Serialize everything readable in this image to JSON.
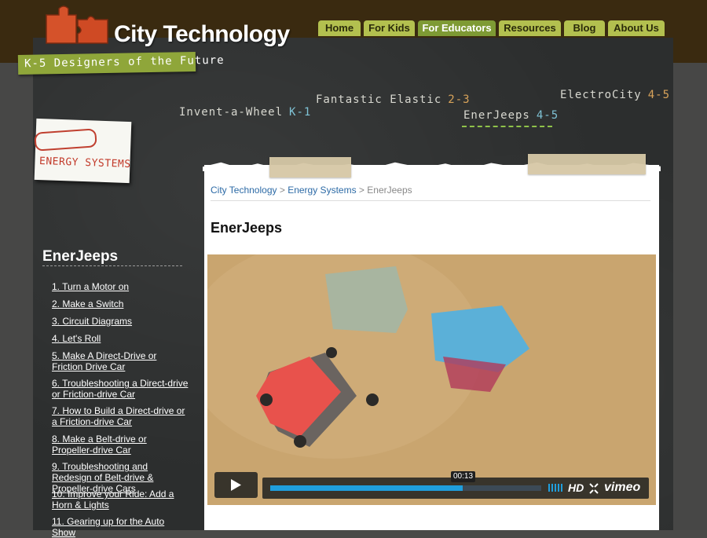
{
  "site": {
    "title": "City Technology",
    "tagline": "K-5 Designers of the Future"
  },
  "nav": {
    "items": [
      {
        "label": "Home"
      },
      {
        "label": "For Kids"
      },
      {
        "label": "For Educators"
      },
      {
        "label": "Resources"
      },
      {
        "label": "Blog"
      },
      {
        "label": "About Us"
      }
    ],
    "active": "For Educators"
  },
  "units": [
    {
      "name": "Invent-a-Wheel",
      "grades": "K-1"
    },
    {
      "name": "Fantastic Elastic",
      "grades": "2-3"
    },
    {
      "name": "EnerJeeps",
      "grades": "4-5"
    },
    {
      "name": "ElectroCity",
      "grades": "4-5"
    }
  ],
  "topic_badge": "ENERGY SYSTEMS",
  "sidebar": {
    "title": "EnerJeeps",
    "items": [
      "1. Turn a Motor on",
      "2. Make a Switch",
      "3. Circuit Diagrams",
      "4. Let's Roll",
      "5. Make A Direct-Drive or Friction Drive Car",
      "6. Troubleshooting a Direct-drive or Friction-drive Car",
      "7. How to Build a Direct-drive or a Friction-drive Car",
      "8. Make a Belt-drive or Propeller-drive Car",
      "9. Troubleshooting and Redesign of Belt-drive & Propeller-drive Cars",
      "10. Improve your Ride: Add a Horn & Lights",
      "11. Gearing up for the Auto Show"
    ]
  },
  "breadcrumb": {
    "home": "City Technology",
    "section": "Energy Systems",
    "current": "EnerJeeps",
    "sep": ">"
  },
  "page_title": "EnerJeeps",
  "video": {
    "timecode": "00:13",
    "progress": 0.71,
    "hd_label": "HD",
    "brand": "vimeo"
  },
  "colors": {
    "accent_green": "#8fa63a",
    "nav_green": "#b3c04f",
    "link_blue": "#2c6aa6",
    "progress_blue": "#1f9edc"
  }
}
